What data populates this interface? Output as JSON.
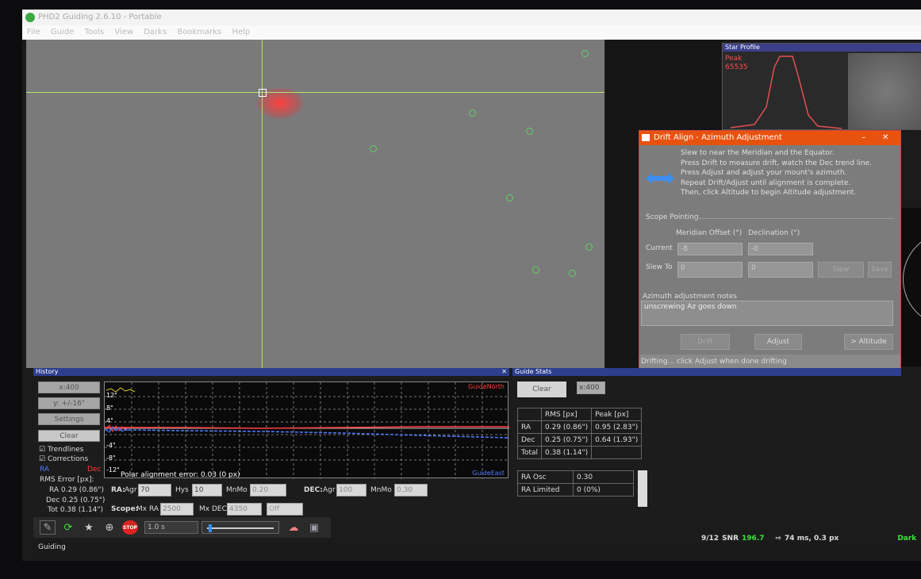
{
  "window": {
    "title": "PHD2 Guiding 2.6.10 - Portable"
  },
  "menu": [
    "File",
    "Guide",
    "Tools",
    "View",
    "Darks",
    "Bookmarks",
    "Help"
  ],
  "star_profile": {
    "header": "Star Profile",
    "peak_label": "Peak",
    "peak_value": "65535"
  },
  "drift": {
    "title": "Drift Align - Azimuth Adjustment",
    "close": "✕",
    "instructions": [
      "Slew to near the Meridian and the Equator.",
      "Press Drift to measure drift, watch the Dec trend line.",
      "Press Adjust and adjust your mount's azimuth.",
      "Repeat Drift/Adjust until alignment is complete.",
      "Then, click Altitude to begin Altitude adjustment."
    ],
    "scope_pointing": "Scope Pointing",
    "col_meridian": "Meridian Offset (°)",
    "col_declination": "Declination (°)",
    "current_label": "Current",
    "current_meridian": "-8",
    "current_dec": "-0",
    "slewto_label": "Slew To",
    "slewto_meridian": "0",
    "slewto_dec": "0",
    "slew_btn": "Slew",
    "save_btn": "Save",
    "notes_label": "Azimuth adjustment notes",
    "notes_text": "unscrewing Az goes down",
    "drift_btn": "Drift",
    "adjust_btn": "Adjust",
    "altitude_btn": "> Altitude",
    "status": "Drifting... click Adjust when done drifting"
  },
  "history": {
    "header": "History",
    "close": "✕",
    "xscale": "x:400",
    "yscale": "y: +/-16\"",
    "settings": "Settings",
    "clear": "Clear",
    "trendlines": "Trendlines",
    "corrections": "Corrections",
    "ra_legend": "RA",
    "dec_legend": "Dec",
    "rms_title": "RMS Error [px]:",
    "rms_ra": "RA 0.29 (0.86\")",
    "rms_dec": "Dec 0.25 (0.75\")",
    "rms_tot": "Tot 0.38 (1.14\")",
    "graph": {
      "guide_north": "GuideNorth",
      "guide_east": "GuideEast",
      "y_ticks": [
        "12\"",
        "8\"",
        "4\"",
        "-4\"",
        "-8\"",
        "-12\""
      ],
      "polar": "Polar alignment error: 0.03 (0 px)"
    },
    "ra_label": "RA:",
    "agr_label": "Agr",
    "ra_agr": "70",
    "hys_label": "Hys",
    "hys": "10",
    "mnmo_label": "MnMo",
    "ra_mnmo": "0.20",
    "dec_label": "DEC:",
    "dec_agr_label": "Agr",
    "dec_agr": "100",
    "dec_mnmo_label": "MnMo",
    "dec_mnmo": "0.30",
    "scope_label": "Scope:",
    "mxra_label": "Mx RA",
    "mxra": "2500",
    "mxdec_label": "Mx DEC",
    "mxdec": "4350",
    "dec_mode": "Off"
  },
  "stats": {
    "header": "Guide Stats",
    "clear": "Clear",
    "xscale": "x:400",
    "table": {
      "headers": [
        "",
        "RMS [px]",
        "Peak [px]"
      ],
      "rows": [
        [
          "RA",
          "0.29 (0.86\")",
          "0.95 (2.83\")"
        ],
        [
          "Dec",
          "0.25 (0.75\")",
          "0.64 (1.93\")"
        ],
        [
          "Total",
          "0.38 (1.14\")",
          ""
        ]
      ]
    },
    "osc_rows": [
      [
        "RA Osc",
        "0.30"
      ],
      [
        "RA Limited",
        "0 (0%)"
      ]
    ]
  },
  "toolbar": {
    "exposure": "1.0 s"
  },
  "status": {
    "left": "Guiding",
    "frames": "9/12",
    "snr_label": "SNR",
    "snr": "196.7",
    "timing": "74 ms, 0.3 px",
    "dark": "Dark"
  },
  "colors": {
    "accent": "#e8520f",
    "ra": "#4f7dff",
    "dec": "#ff3b3b",
    "snr": "#3ce03c"
  }
}
